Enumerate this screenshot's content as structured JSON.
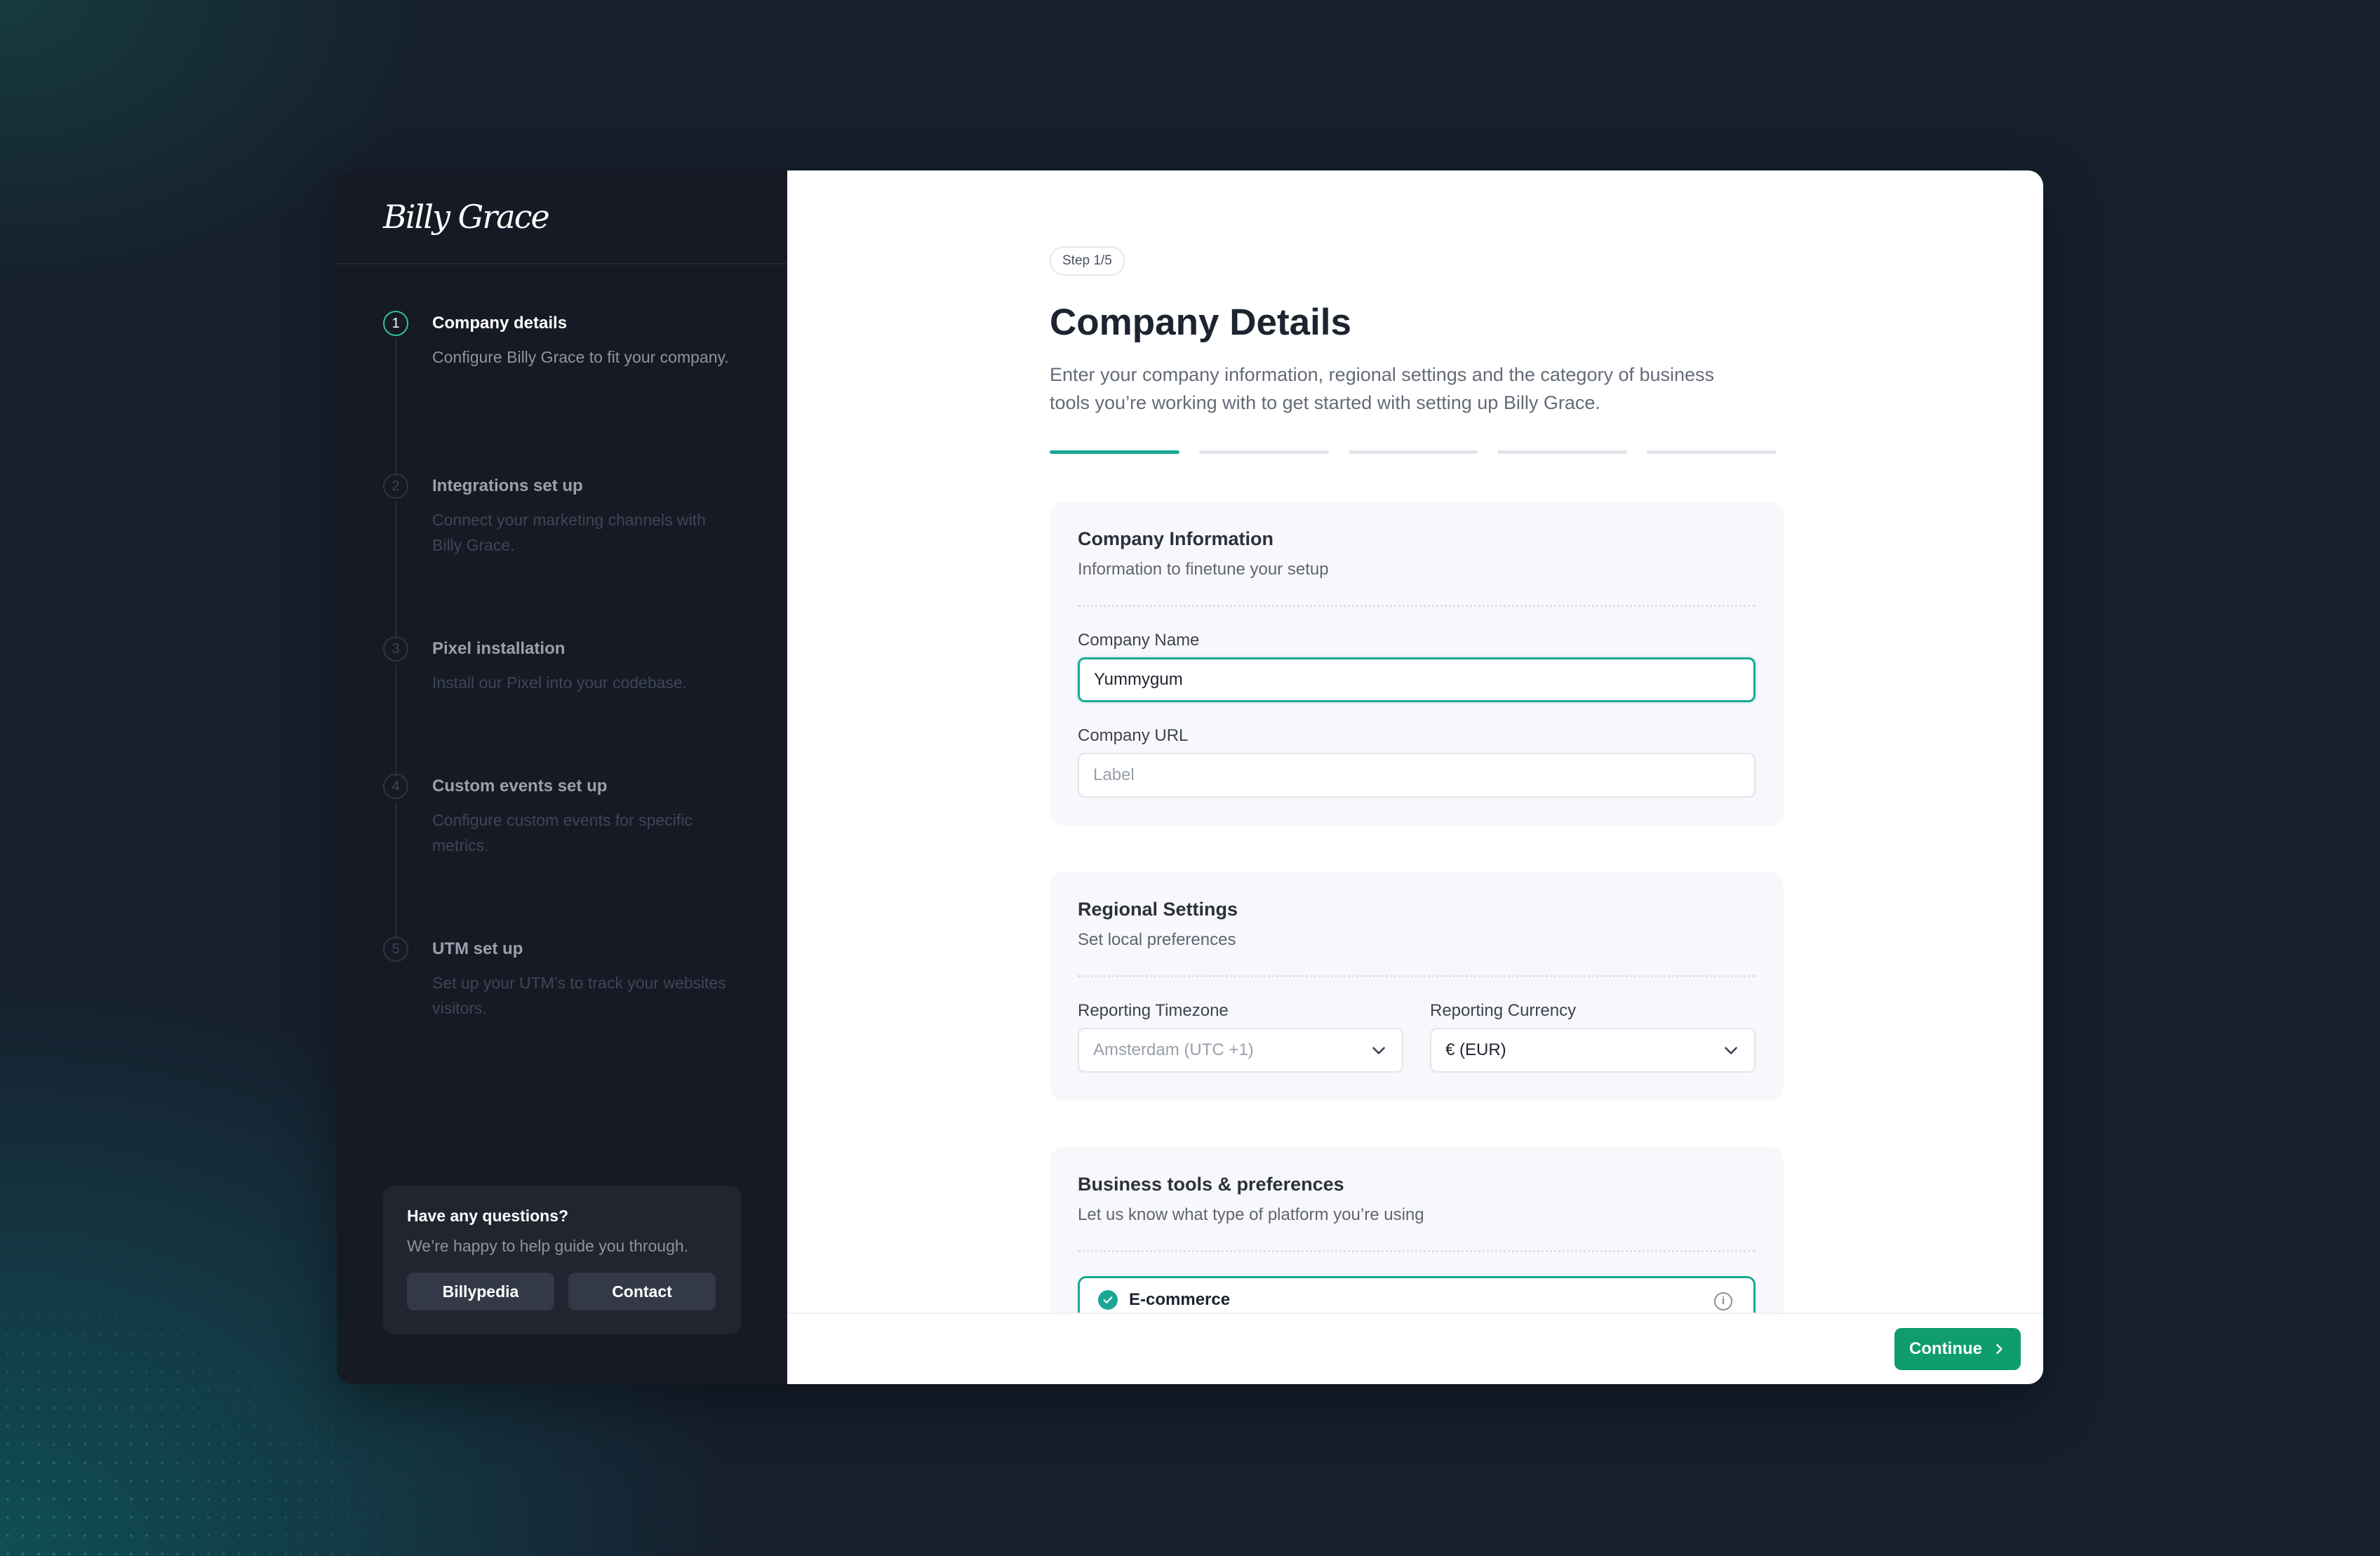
{
  "app": {
    "logo": "Billy Grace"
  },
  "sidebar": {
    "steps": [
      {
        "num": "1",
        "title": "Company details",
        "desc": "Configure Billy Grace to fit your company."
      },
      {
        "num": "2",
        "title": "Integrations set up",
        "desc": "Connect your marketing channels with Billy Grace."
      },
      {
        "num": "3",
        "title": "Pixel installation",
        "desc": "Install our Pixel into your codebase."
      },
      {
        "num": "4",
        "title": "Custom events set up",
        "desc": "Configure custom events for specific metrics."
      },
      {
        "num": "5",
        "title": "UTM set up",
        "desc": "Set up your UTM’s to track your websites visitors."
      }
    ],
    "help": {
      "title": "Have any questions?",
      "desc": "We’re happy to help guide you through.",
      "btn1": "Billypedia",
      "btn2": "Contact"
    }
  },
  "main": {
    "step_badge": "Step 1/5",
    "title": "Company Details",
    "subtitle": "Enter your company information, regional settings and the category of business tools you’re working with to get started with setting up Billy Grace.",
    "progress": {
      "current": 1,
      "total": 5
    },
    "company_info": {
      "title": "Company Information",
      "sub": "Information to finetune your setup",
      "name_label": "Company Name",
      "name_value": "Yummygum",
      "url_label": "Company URL",
      "url_placeholder": "Label"
    },
    "regional": {
      "title": "Regional Settings",
      "sub": "Set local preferences",
      "tz_label": "Reporting Timezone",
      "tz_value": "Amsterdam (UTC +1)",
      "cur_label": "Reporting Currency",
      "cur_value": "€ (EUR)"
    },
    "business": {
      "title": "Business tools & preferences",
      "sub": "Let us know what type of platform you’re using",
      "option": "E-commerce"
    },
    "continue": "Continue"
  },
  "colors": {
    "accent": "#1aa894",
    "button": "#0f9d6f",
    "sidebar": "#161a24"
  }
}
